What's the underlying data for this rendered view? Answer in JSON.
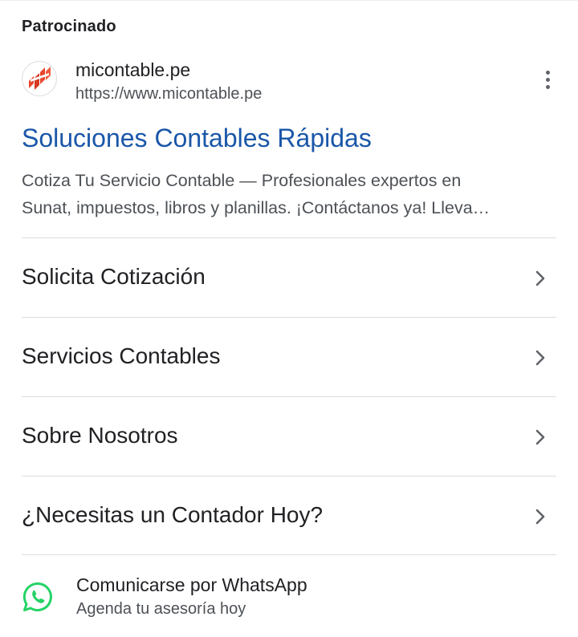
{
  "ad": {
    "sponsored_label": "Patrocinado",
    "site_name": "micontable.pe",
    "site_url": "https://www.micontable.pe",
    "title": "Soluciones Contables Rápidas",
    "description_line1": "Cotiza Tu Servicio Contable — Profesionales expertos en",
    "description_line2": "Sunat, impuestos, libros y planillas. ¡Contáctanos ya! Lleva…",
    "title_color": "#1a57a8",
    "logo_icon": "micontable-logo-icon",
    "menu_icon": "more-vert-icon"
  },
  "sitelinks": [
    {
      "label": "Solicita Cotización",
      "icon": "chevron-right-icon"
    },
    {
      "label": "Servicios Contables",
      "icon": "chevron-right-icon"
    },
    {
      "label": "Sobre Nosotros",
      "icon": "chevron-right-icon"
    },
    {
      "label": "¿Necesitas un Contador Hoy?",
      "icon": "chevron-right-icon"
    }
  ],
  "whatsapp": {
    "title": "Comunicarse por WhatsApp",
    "subtitle": "Agenda tu asesoría hoy",
    "icon": "whatsapp-icon",
    "color": "#25d366"
  }
}
